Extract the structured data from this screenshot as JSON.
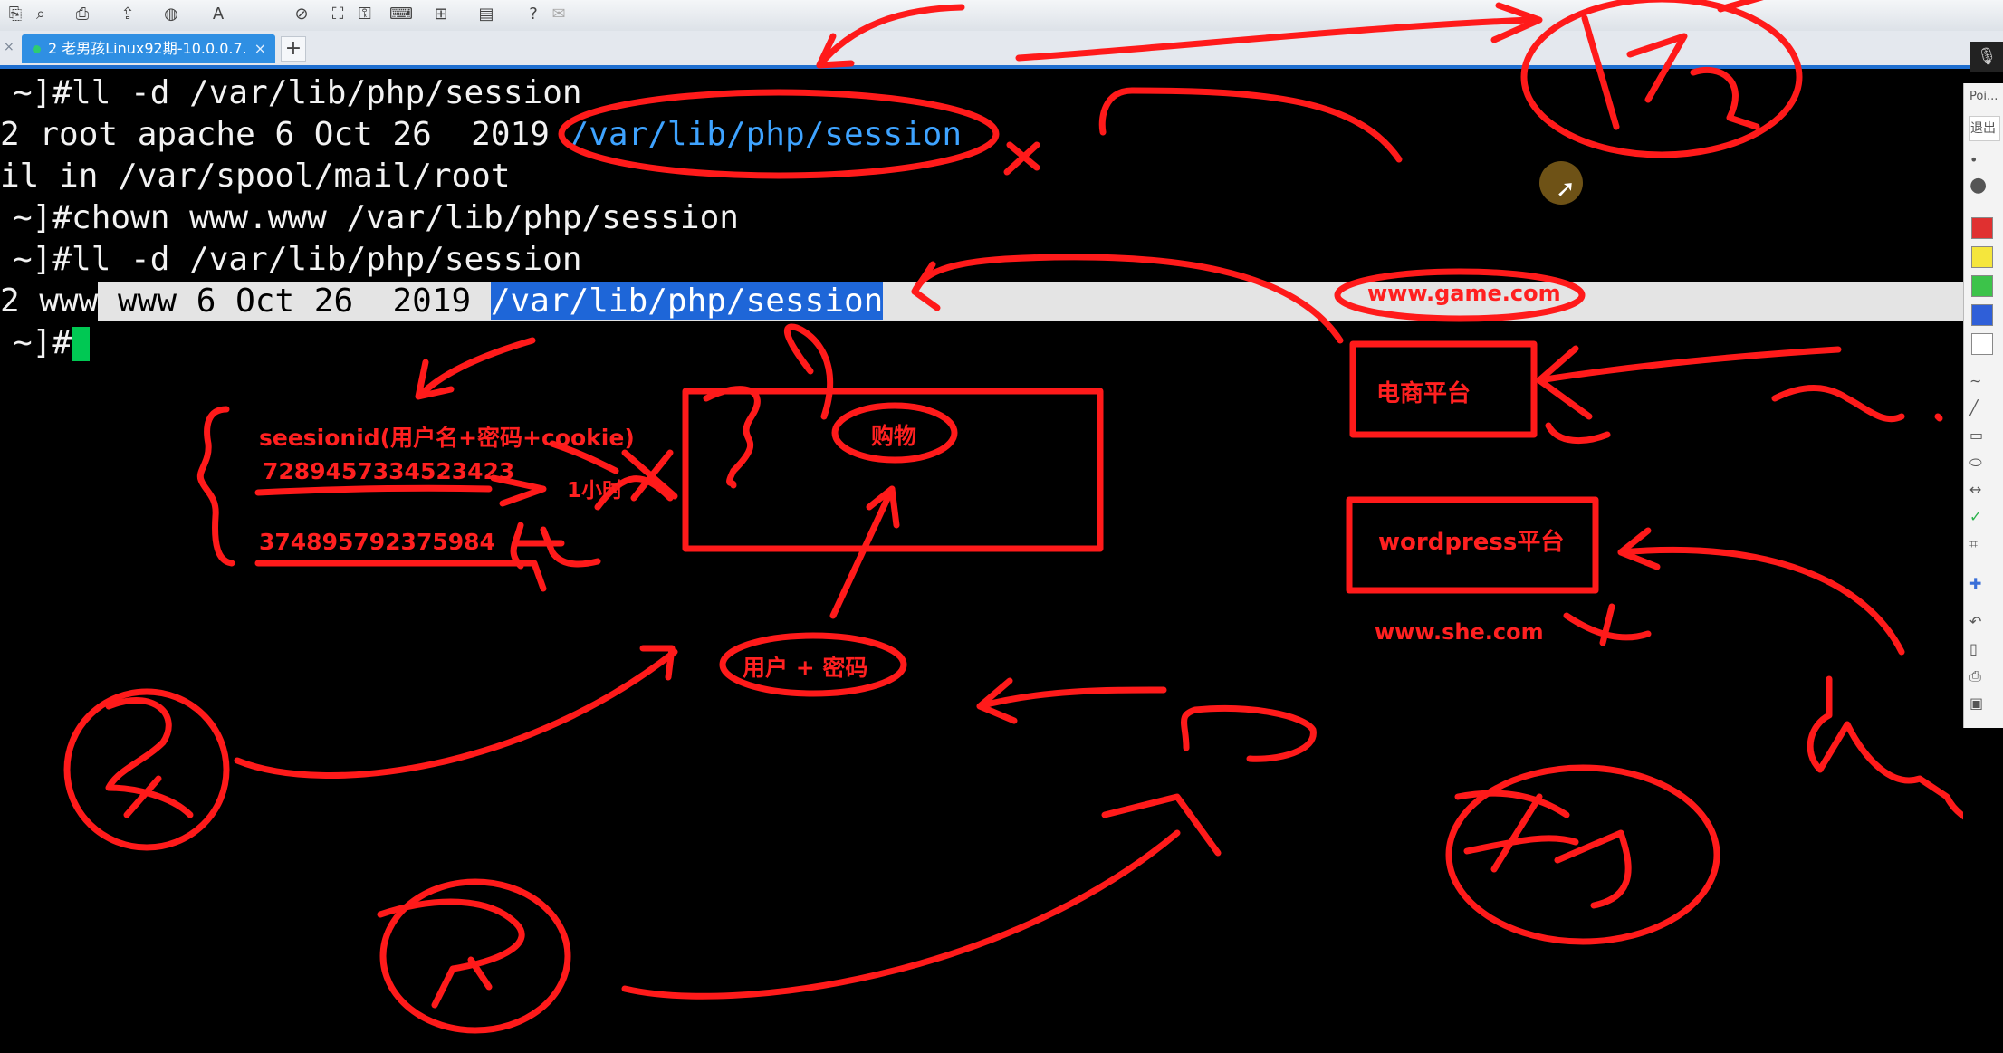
{
  "window": {
    "tab_title": "2 老男孩Linux92期-10.0.0.7...",
    "tab_close": "×",
    "tab_add": "+",
    "left_close": "×"
  },
  "toolbar": {
    "icons": [
      "paste-icon",
      "search-icon",
      "printer-icon",
      "transfer-icon",
      "globe-icon",
      "font-icon",
      "disconnect-icon",
      "fullscreen-icon",
      "lock-icon",
      "keyboard-icon",
      "add-session-icon",
      "layout-icon",
      "help-icon",
      "chat-icon"
    ]
  },
  "terminal": {
    "line1": "~]#ll -d /var/lib/php/session",
    "line2_prefix": "2 root apache 6 Oct 26  2019 ",
    "line2_path": "/var/lib/php/session",
    "line3": "il in /var/spool/mail/root",
    "line4": "~]#chown www.www /var/lib/php/session",
    "line5": "~]#ll -d /var/lib/php/session",
    "line6_prefix": "2 www",
    "line6_mid": " www 6 Oct 26  2019 ",
    "line6_path": "/var/lib/php/session",
    "line7_prompt": "~]#"
  },
  "annotations": {
    "site_game": "www.game.com",
    "ecommerce": "电商平台",
    "wordpress": "wordpress平台",
    "site_she": "www.she.com",
    "session_label": "seesionid(用户名+密码+cookie)",
    "session_id_1": "7289457334523423",
    "session_id_2": "374895792375984",
    "expire": "1小时",
    "shopping": "购物",
    "user_pass": "用户 + 密码"
  },
  "side_panel": {
    "search_label": "Poi...",
    "exit_label": "退出",
    "colors": [
      "#e03030",
      "#f5e63c",
      "#3cc34a",
      "#2f5fd8",
      "#ffffff"
    ]
  },
  "colors": {
    "ink": "#ff1a1a",
    "terminal_bg": "#000000",
    "highlight_path": "#3ea3ff",
    "selection": "#1e66d8",
    "tab_active": "#2f8fe3"
  }
}
